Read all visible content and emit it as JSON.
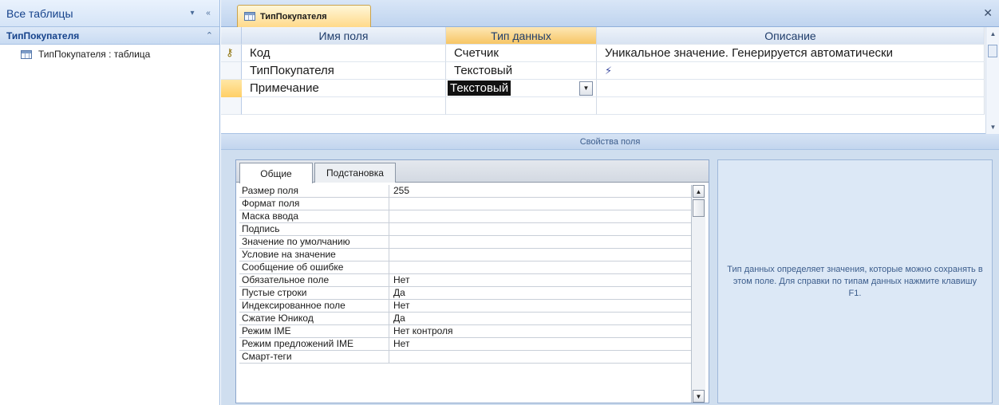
{
  "nav": {
    "title": "Все таблицы",
    "dropdown_glyph": "▾",
    "shutter_glyph": "«",
    "group_label": "ТипПокупателя",
    "group_collapse_glyph": "⌃",
    "item_label": "ТипПокупателя : таблица"
  },
  "document": {
    "tab_label": "ТипПокупателя",
    "close_glyph": "✕"
  },
  "design_grid": {
    "columns": [
      "Имя поля",
      "Тип данных",
      "Описание"
    ],
    "rows": [
      {
        "name": "Код",
        "type": "Счетчик",
        "description": "Уникальное значение. Генерируется автоматически"
      },
      {
        "name": "ТипПокупателя",
        "type": "Текстовый",
        "description": ""
      },
      {
        "name": "Примечание",
        "type": "Текстовый",
        "description": ""
      }
    ],
    "selected_type_value": "Текстовый"
  },
  "field_properties": {
    "header": "Свойства поля",
    "tabs": [
      "Общие",
      "Подстановка"
    ],
    "properties": [
      {
        "label": "Размер поля",
        "value": "255"
      },
      {
        "label": "Формат поля",
        "value": ""
      },
      {
        "label": "Маска ввода",
        "value": ""
      },
      {
        "label": "Подпись",
        "value": ""
      },
      {
        "label": "Значение по умолчанию",
        "value": ""
      },
      {
        "label": "Условие на значение",
        "value": ""
      },
      {
        "label": "Сообщение об ошибке",
        "value": ""
      },
      {
        "label": "Обязательное поле",
        "value": "Нет"
      },
      {
        "label": "Пустые строки",
        "value": "Да"
      },
      {
        "label": "Индексированное поле",
        "value": "Нет"
      },
      {
        "label": "Сжатие Юникод",
        "value": "Да"
      },
      {
        "label": "Режим IME",
        "value": "Нет контроля"
      },
      {
        "label": "Режим предложений IME",
        "value": "Нет"
      },
      {
        "label": "Смарт-теги",
        "value": ""
      }
    ],
    "help_text": "Тип данных определяет значения, которые можно сохранять в этом поле.  Для справки по типам данных нажмите клавишу F1."
  },
  "colors": {
    "accent_orange": "#f7c665",
    "nav_title": "#15428b",
    "panel_blue": "#cfdeef"
  }
}
